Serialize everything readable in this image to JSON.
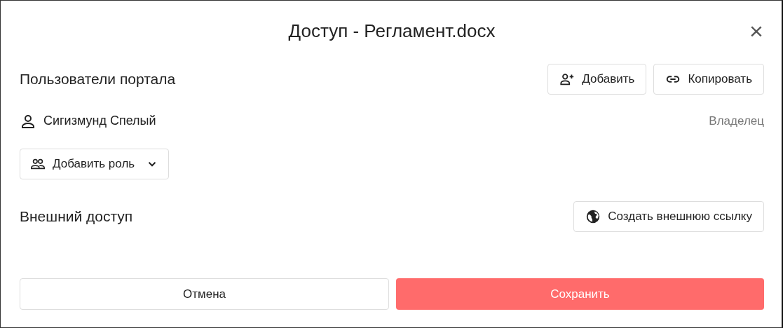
{
  "dialog": {
    "title": "Доступ - Регламент.docx",
    "close": "×"
  },
  "portal_users": {
    "heading": "Пользователи портала",
    "buttons": [
      {
        "label": "Добавить"
      },
      {
        "label": "Копировать"
      }
    ],
    "users": [
      {
        "name": "Сигизмунд Спелый",
        "role": "Владелец"
      }
    ],
    "role_dropdown": {
      "label": "Добавить роль"
    }
  },
  "external_access": {
    "heading": "Внешний доступ",
    "button": {
      "label": "Создать внешнюю ссылку"
    }
  },
  "footer_buttons": [
    {
      "label": "Отмена",
      "kind": "secondary"
    },
    {
      "label": "Сохранить",
      "kind": "primary"
    }
  ]
}
